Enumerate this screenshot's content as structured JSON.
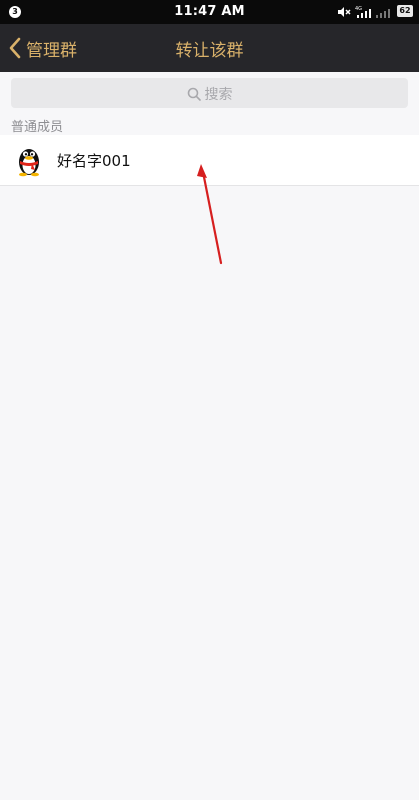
{
  "status_bar": {
    "notification_count": "3",
    "time": "11:47 AM",
    "battery": "62",
    "network_badge": "4G",
    "icons": [
      "mute-icon",
      "signal-icon",
      "battery-icon"
    ]
  },
  "nav": {
    "back_label": "管理群",
    "title": "转让该群",
    "accent_color": "#d9b16a"
  },
  "search": {
    "placeholder": "搜索"
  },
  "section": {
    "header": "普通成员"
  },
  "members": [
    {
      "name": "好名字001",
      "avatar_icon": "qq-penguin-avatar-icon"
    }
  ],
  "annotation": {
    "color": "#d61f1f"
  }
}
